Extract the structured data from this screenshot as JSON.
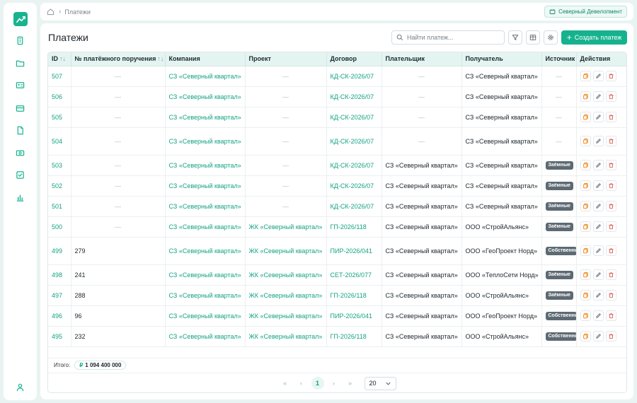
{
  "sidebar": {
    "icons": [
      "logo-chart-icon",
      "building-icon",
      "folder-icon",
      "id-card-icon",
      "credit-card-icon",
      "document-icon",
      "banknote-icon",
      "checklist-icon",
      "bar-chart-icon",
      "user-icon"
    ]
  },
  "breadcrumb": {
    "current": "Платежи"
  },
  "company": {
    "name": "Северный Девелопмент"
  },
  "page": {
    "title": "Платежи"
  },
  "search": {
    "placeholder": "Найти платеж..."
  },
  "toolbar": {
    "create_label": "Создать платеж"
  },
  "colors": {
    "accent": "#16b28e",
    "badge": "#5d6a73",
    "delete": "#e05a4f",
    "copy": "#f08a1c"
  },
  "table": {
    "columns": [
      "ID",
      "№ платёжного поручения",
      "Компания",
      "Проект",
      "Договор",
      "Плательщик",
      "Получатель",
      "Источник",
      "Действия"
    ],
    "rows": [
      {
        "id": "507",
        "order": "—",
        "company": "СЗ «Северный квартал»",
        "project": "—",
        "contract": "КД-СК-2026/07",
        "payer": "—",
        "receiver": "СЗ «Северный квартал»",
        "source": "—"
      },
      {
        "id": "506",
        "order": "—",
        "company": "СЗ «Северный квартал»",
        "project": "—",
        "contract": "КД-СК-2026/07",
        "payer": "—",
        "receiver": "СЗ «Северный квартал»",
        "source": "—"
      },
      {
        "id": "505",
        "order": "—",
        "company": "СЗ «Северный квартал»",
        "project": "—",
        "contract": "КД-СК-2026/07",
        "payer": "—",
        "receiver": "СЗ «Северный квартал»",
        "source": "—"
      },
      {
        "id": "504",
        "order": "—",
        "company": "СЗ «Северный квартал»",
        "project": "—",
        "contract": "КД-СК-2026/07",
        "payer": "—",
        "receiver": "СЗ «Северный квартал»",
        "source": "—"
      },
      {
        "id": "503",
        "order": "—",
        "company": "СЗ «Северный квартал»",
        "project": "—",
        "contract": "КД-СК-2026/07",
        "payer": "СЗ «Северный квартал»",
        "receiver": "СЗ «Северный квартал»",
        "source": "Заёмные"
      },
      {
        "id": "502",
        "order": "—",
        "company": "СЗ «Северный квартал»",
        "project": "—",
        "contract": "КД-СК-2026/07",
        "payer": "СЗ «Северный квартал»",
        "receiver": "СЗ «Северный квартал»",
        "source": "Заёмные"
      },
      {
        "id": "501",
        "order": "—",
        "company": "СЗ «Северный квартал»",
        "project": "—",
        "contract": "КД-СК-2026/07",
        "payer": "СЗ «Северный квартал»",
        "receiver": "СЗ «Северный квартал»",
        "source": "Заёмные"
      },
      {
        "id": "500",
        "order": "—",
        "company": "СЗ «Северный квартал»",
        "project": "ЖК «Северный квартал»",
        "contract": "ГП-2026/118",
        "payer": "СЗ «Северный квартал»",
        "receiver": "ООО «СтройАльянс»",
        "source": "Заёмные"
      },
      {
        "id": "499",
        "order": "279",
        "company": "СЗ «Северный квартал»",
        "project": "ЖК «Северный квартал»",
        "contract": "ПИР-2026/041",
        "payer": "СЗ «Северный квартал»",
        "receiver": "ООО «ГеоПроект Норд»",
        "source": "Собственные"
      },
      {
        "id": "498",
        "order": "241",
        "company": "СЗ «Северный квартал»",
        "project": "ЖК «Северный квартал»",
        "contract": "СЕТ-2026/077",
        "payer": "СЗ «Северный квартал»",
        "receiver": "ООО «ТеплоСети Норд»",
        "source": "Заёмные"
      },
      {
        "id": "497",
        "order": "288",
        "company": "СЗ «Северный квартал»",
        "project": "ЖК «Северный квартал»",
        "contract": "ГП-2026/118",
        "payer": "СЗ «Северный квартал»",
        "receiver": "ООО «СтройАльянс»",
        "source": "Заёмные"
      },
      {
        "id": "496",
        "order": "96",
        "company": "СЗ «Северный квартал»",
        "project": "ЖК «Северный квартал»",
        "contract": "ПИР-2026/041",
        "payer": "СЗ «Северный квартал»",
        "receiver": "ООО «ГеоПроект Норд»",
        "source": "Собственные"
      },
      {
        "id": "495",
        "order": "232",
        "company": "СЗ «Северный квартал»",
        "project": "ЖК «Северный квартал»",
        "contract": "ГП-2026/118",
        "payer": "СЗ «Северный квартал»",
        "receiver": "ООО «СтройАльянс»",
        "source": "Собственные"
      }
    ]
  },
  "footer": {
    "total_label": "Итого:",
    "total_currency": "₽",
    "total_value": "1 094 400 000",
    "pagination": {
      "first": "«",
      "prev": "‹",
      "current_page": "1",
      "next": "›",
      "last": "»",
      "per_page": "20"
    }
  }
}
